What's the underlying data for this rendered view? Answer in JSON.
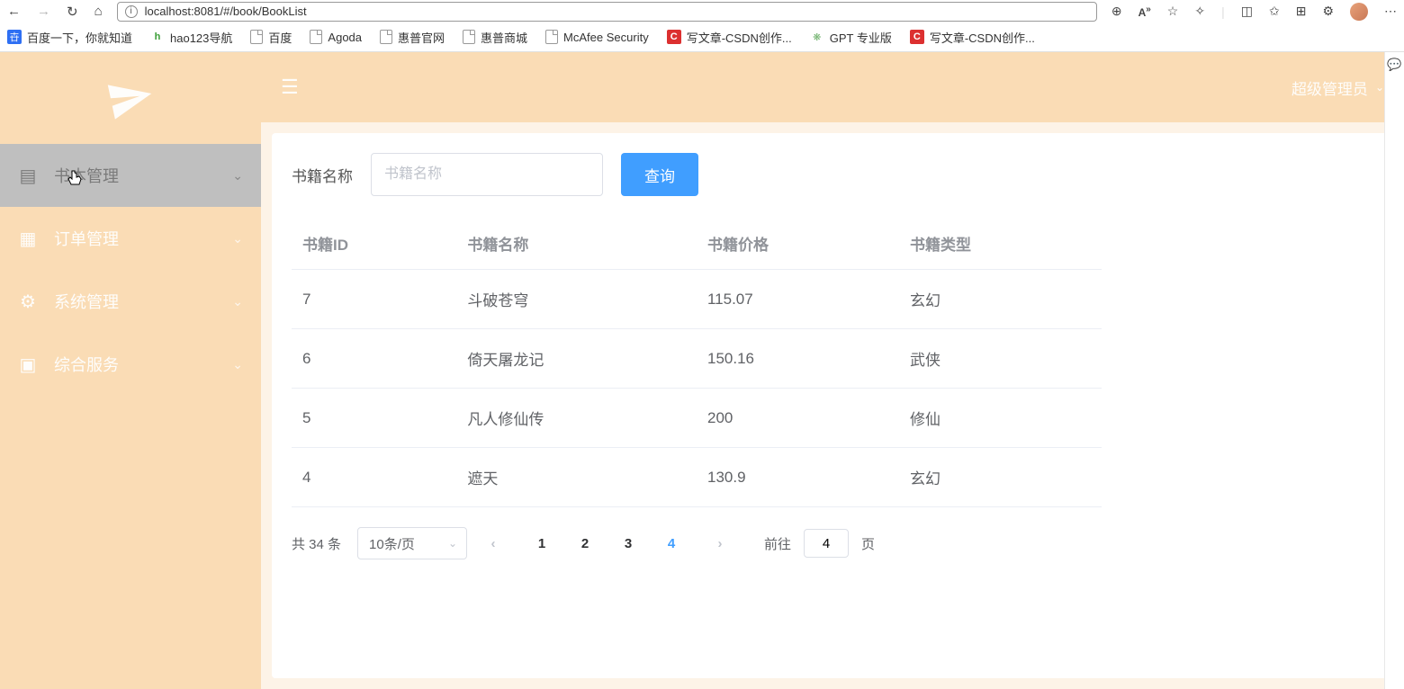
{
  "browser": {
    "url": "localhost:8081/#/book/BookList",
    "bookmarks": [
      {
        "icon": "baidu",
        "label": "百度一下，你就知道"
      },
      {
        "icon": "hao",
        "label": "hao123导航"
      },
      {
        "icon": "doc",
        "label": "百度"
      },
      {
        "icon": "doc",
        "label": "Agoda"
      },
      {
        "icon": "doc",
        "label": "惠普官网"
      },
      {
        "icon": "doc",
        "label": "惠普商城"
      },
      {
        "icon": "doc",
        "label": "McAfee Security"
      },
      {
        "icon": "csdn",
        "label": "写文章-CSDN创作..."
      },
      {
        "icon": "gpt",
        "label": "GPT 专业版"
      },
      {
        "icon": "csdn",
        "label": "写文章-CSDN创作..."
      }
    ]
  },
  "sidebar": {
    "items": [
      {
        "icon": "book",
        "label": "书本管理",
        "active": true
      },
      {
        "icon": "order",
        "label": "订单管理",
        "active": false
      },
      {
        "icon": "gear",
        "label": "系统管理",
        "active": false
      },
      {
        "icon": "service",
        "label": "综合服务",
        "active": false
      }
    ]
  },
  "topbar": {
    "user_name": "超级管理员"
  },
  "search": {
    "label": "书籍名称",
    "placeholder": "书籍名称",
    "button": "查询"
  },
  "table": {
    "columns": [
      "书籍ID",
      "书籍名称",
      "书籍价格",
      "书籍类型"
    ],
    "rows": [
      {
        "id": "7",
        "name": "斗破苍穹",
        "price": "115.07",
        "type": "玄幻"
      },
      {
        "id": "6",
        "name": "倚天屠龙记",
        "price": "150.16",
        "type": "武侠"
      },
      {
        "id": "5",
        "name": "凡人修仙传",
        "price": "200",
        "type": "修仙"
      },
      {
        "id": "4",
        "name": "遮天",
        "price": "130.9",
        "type": "玄幻"
      }
    ]
  },
  "pagination": {
    "total_label": "共 34 条",
    "page_size": "10条/页",
    "pages": [
      "1",
      "2",
      "3",
      "4"
    ],
    "current": "4",
    "goto_prefix": "前往",
    "goto_value": "4",
    "goto_suffix": "页"
  },
  "colors": {
    "sidebar_bg": "#fadcb5",
    "accent": "#409eff",
    "active_menu": "#bfbfbf"
  }
}
